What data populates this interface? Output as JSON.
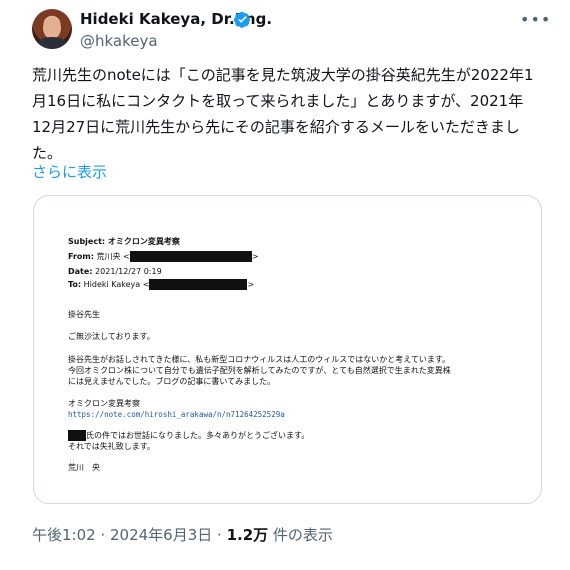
{
  "author": {
    "name": "Hideki Kakeya, Dr.Eng.",
    "handle": "@hkakeya"
  },
  "tweet": {
    "text": "荒川先生のnoteには「この記事を見た筑波大学の掛谷英紀先生が2022年1月16日に私にコンタクトを取って来られました」とありますが、2021年12月27日に荒川先生から先にその記事を紹介するメールをいただきました。",
    "show_more": "さらに表示"
  },
  "email": {
    "subject_label": "Subject:",
    "subject": "オミクロン変異考察",
    "from_label": "From:",
    "from_name": "荒川央 <",
    "from_end": ">",
    "date_label": "Date:",
    "date": "2021/12/27 0:19",
    "to_label": "To:",
    "to_name": "Hideki Kakeya <",
    "to_end": ">",
    "greeting": "掛谷先生",
    "line1": "ご無沙汰しております。",
    "line2": "掛谷先生がお話しされてきた様に、私も新型コロナウィルスは人工のウィルスではないかと考えています。",
    "line3": "今回オミクロン株について自分でも遺伝子配列を解析してみたのですが、とても自然選択で生まれた変異株",
    "line4": "には見えませんでした。ブログの記事に書いてみました。",
    "article_title": "オミクロン変異考察",
    "article_url": "https://note.com/hiroshi_arakawa/n/n71264252529a",
    "line5": "氏の件ではお世話になりました。多々ありがとうございます。",
    "line6": "それでは失礼致します。",
    "signature": "荒川　央"
  },
  "footer": {
    "time": "午後1:02",
    "sep1": " · ",
    "date": "2024年6月3日",
    "sep2": " · ",
    "views": "1.2万",
    "views_label": " 件の表示"
  },
  "colors": {
    "accent": "#1d9bf0",
    "muted": "#536471",
    "border": "#cfd9de"
  },
  "icons": [
    "verified-badge-icon",
    "more-options-icon"
  ]
}
